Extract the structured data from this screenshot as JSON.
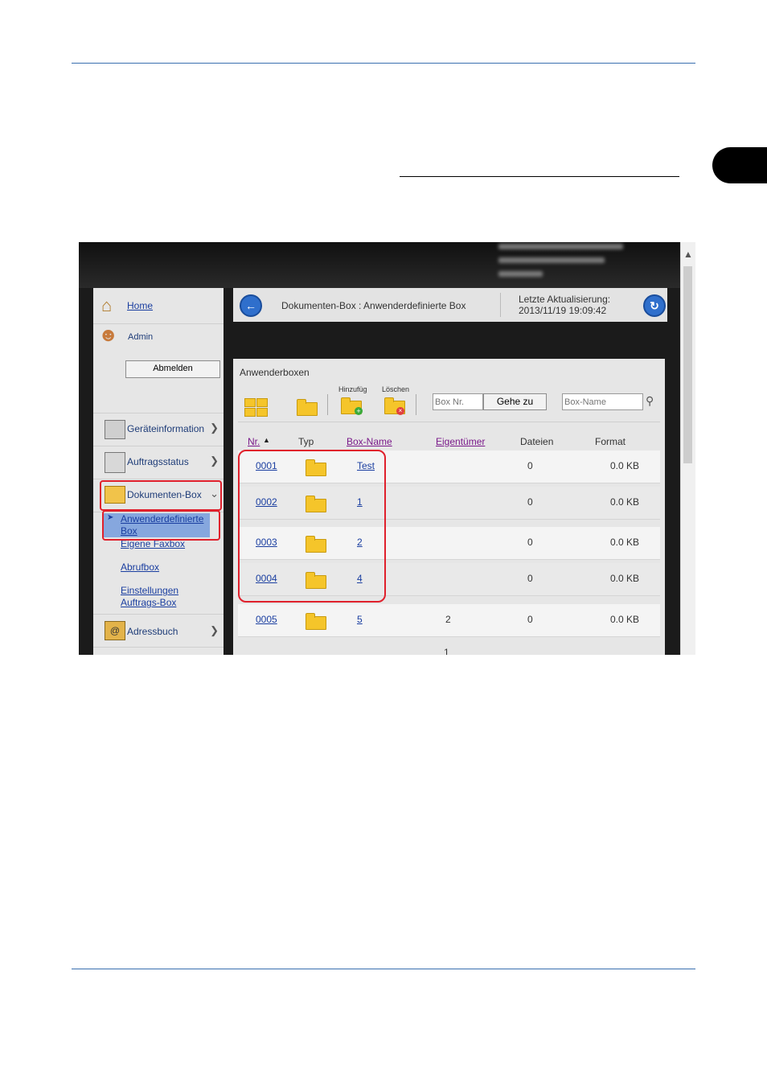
{
  "ui": {
    "nav": {
      "home": "Home",
      "user": "Admin",
      "logout": "Abmelden",
      "items": [
        {
          "label": "Geräteinformation"
        },
        {
          "label": "Auftragsstatus"
        },
        {
          "label": "Dokumenten-Box"
        },
        {
          "label": "Adressbuch"
        }
      ],
      "sub_items": [
        {
          "label_l1": "Anwenderdefinierte",
          "label_l2": "Box"
        },
        {
          "label": "Eigene Faxbox"
        },
        {
          "label": "Abrufbox"
        },
        {
          "label_l1": "Einstellungen",
          "label_l2": "Auftrags-Box"
        }
      ]
    },
    "header": {
      "breadcrumb": "Dokumenten-Box : Anwenderdefinierte Box",
      "last_update_label": "Letzte Aktualisierung:",
      "last_update_value": "2013/11/19 19:09:42"
    },
    "panel": {
      "title": "Anwenderboxen",
      "add_label": "Hinzufüg",
      "delete_label": "Löschen",
      "box_nr_placeholder": "Box Nr.",
      "go_button": "Gehe zu",
      "box_name_placeholder": "Box-Name",
      "columns": [
        "Nr.",
        "Typ",
        "Box-Name",
        "Eigentümer",
        "Dateien",
        "Format"
      ],
      "rows": [
        {
          "nr": "0001",
          "name": "Test",
          "owner": "",
          "files": "0",
          "format": "0.0 KB"
        },
        {
          "nr": "0002",
          "name": "1",
          "owner": "",
          "files": "0",
          "format": "0.0 KB"
        },
        {
          "nr": "0003",
          "name": "2",
          "owner": "",
          "files": "0",
          "format": "0.0 KB"
        },
        {
          "nr": "0004",
          "name": "4",
          "owner": "",
          "files": "0",
          "format": "0.0 KB"
        },
        {
          "nr": "0005",
          "name": "5",
          "owner": "2",
          "files": "0",
          "format": "0.0 KB"
        }
      ],
      "page": "1"
    },
    "colors": {
      "accent": "#2f6fcc",
      "highlight": "#e0202c",
      "rule": "#3a6fb0"
    }
  }
}
